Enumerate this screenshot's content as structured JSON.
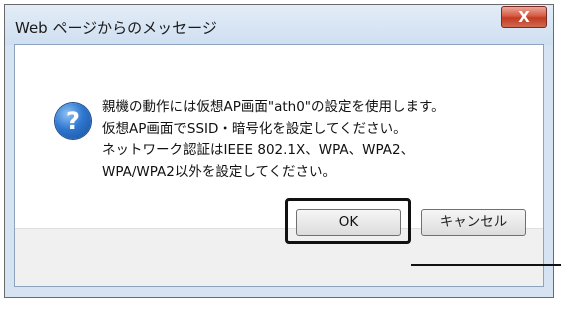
{
  "dialog": {
    "title": "Web ページからのメッセージ",
    "close_label": "X",
    "message_lines": [
      "親機の動作には仮想AP画面\"ath0\"の設定を使用します。",
      "仮想AP画面でSSID・暗号化を設定してください。",
      "ネットワーク認証はIEEE 802.1X、WPA、WPA2、",
      "WPA/WPA2以外を設定してください。"
    ],
    "ok_label": "OK",
    "cancel_label": "キャンセル",
    "icon": "question-icon"
  }
}
